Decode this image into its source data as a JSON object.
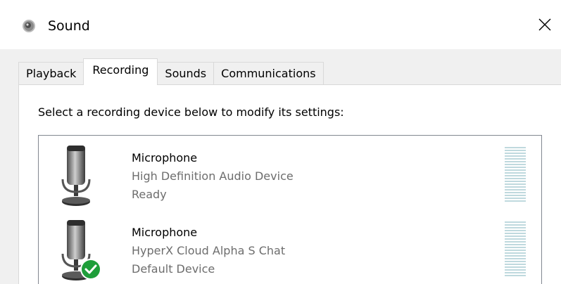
{
  "window": {
    "title": "Sound",
    "icon": "speaker-icon",
    "close_glyph": "✕"
  },
  "tabs": [
    {
      "label": "Playback",
      "active": false
    },
    {
      "label": "Recording",
      "active": true
    },
    {
      "label": "Sounds",
      "active": false
    },
    {
      "label": "Communications",
      "active": false
    }
  ],
  "recording": {
    "instruction": "Select a recording device below to modify its settings:",
    "devices": [
      {
        "name": "Microphone",
        "description": "High Definition Audio Device",
        "status": "Ready",
        "is_default": false,
        "icon": "microphone-icon",
        "level": 0
      },
      {
        "name": "Microphone",
        "description": "HyperX Cloud Alpha S Chat",
        "status": "Default Device",
        "is_default": true,
        "icon": "microphone-icon",
        "badge_icon": "default-check-icon",
        "level": 0
      }
    ]
  },
  "colors": {
    "meter_bar": "#bfd9de",
    "default_badge": "#1e9e3a",
    "secondary_text": "#6d6d6d"
  }
}
